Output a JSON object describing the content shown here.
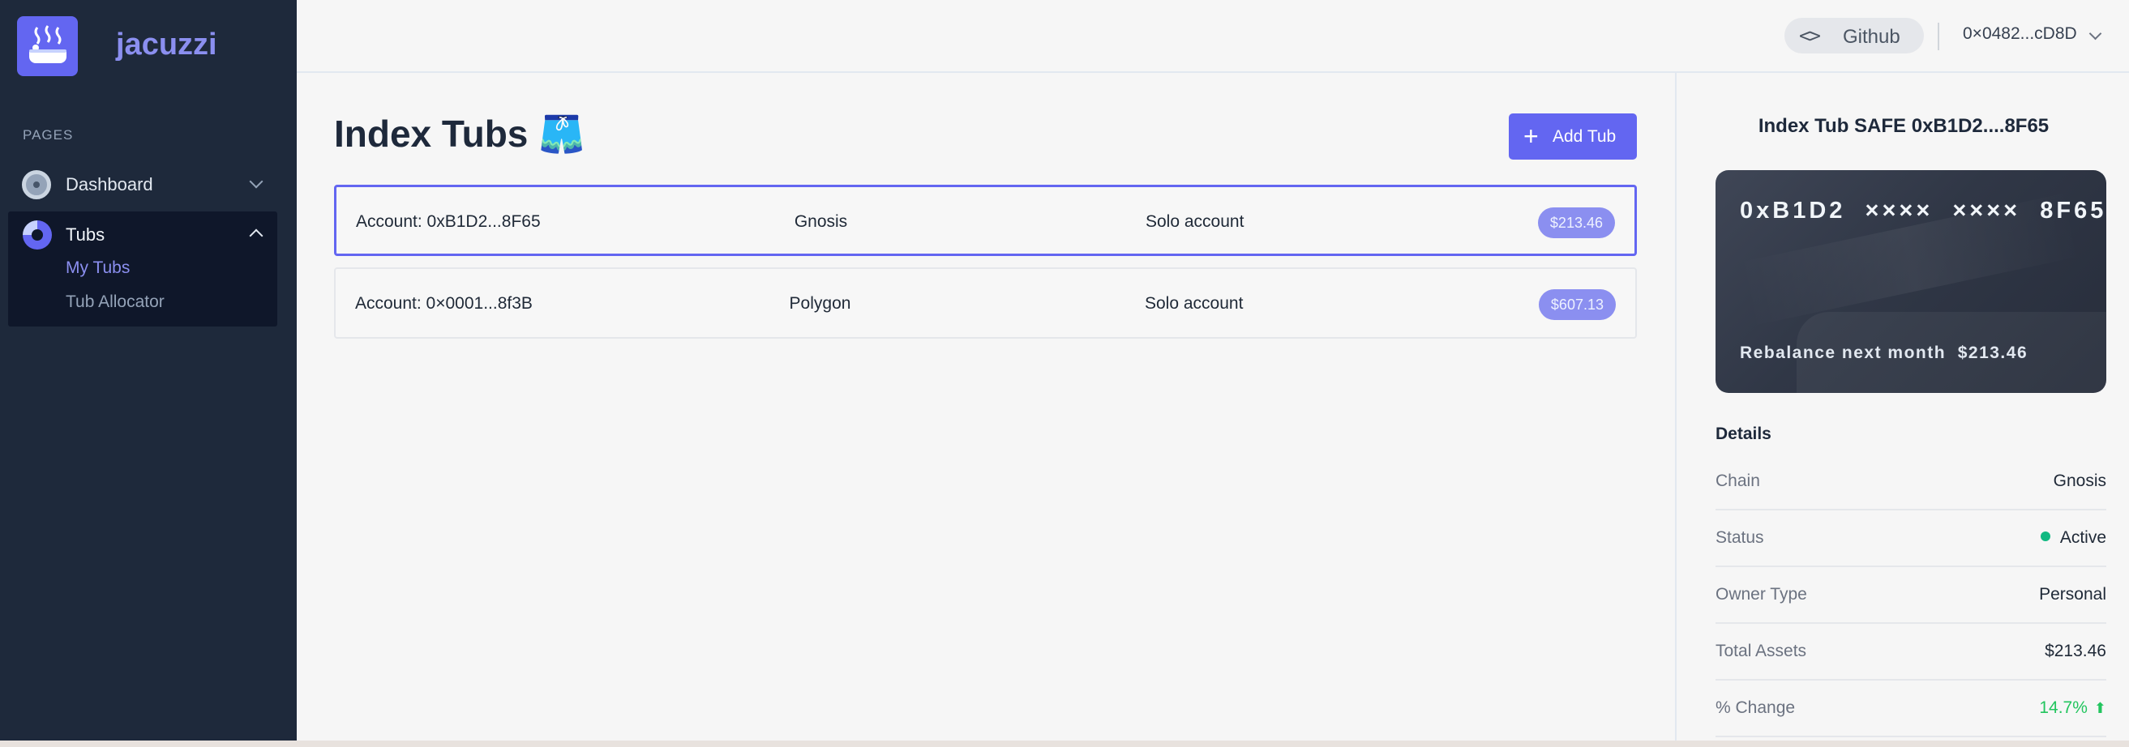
{
  "app": {
    "name": "jacuzzi"
  },
  "sidebar": {
    "section_label": "PAGES",
    "items": [
      {
        "label": "Dashboard",
        "icon": "dashboard-icon",
        "expanded": false
      },
      {
        "label": "Tubs",
        "icon": "pie-chart-icon",
        "expanded": true,
        "children": [
          {
            "label": "My Tubs",
            "active": true
          },
          {
            "label": "Tub Allocator",
            "active": false
          }
        ]
      }
    ]
  },
  "header": {
    "github_label": "Github",
    "github_icon": "code-icon",
    "wallet": "0×0482...cD8D"
  },
  "main": {
    "title": "Index Tubs 🩳",
    "add_button": "Add Tub",
    "tubs": [
      {
        "account": "Account: 0xB1D2...8F65",
        "chain": "Gnosis",
        "type": "Solo account",
        "balance": "$213.46",
        "selected": true
      },
      {
        "account": "Account: 0×0001...8f3B",
        "chain": "Polygon",
        "type": "Solo account",
        "balance": "$607.13",
        "selected": false
      }
    ]
  },
  "detail": {
    "title": "Index Tub SAFE 0xB1D2....8F65",
    "card_number": "0xB1D2  ××××  ××××  8F65",
    "card_footer": "Rebalance next month  $213.46",
    "details_heading": "Details",
    "rows": [
      {
        "key": "Chain",
        "value": "Gnosis"
      },
      {
        "key": "Status",
        "value": "Active"
      },
      {
        "key": "Owner Type",
        "value": "Personal"
      },
      {
        "key": "Total Assets",
        "value": "$213.46"
      },
      {
        "key": "% Change",
        "value": "14.7%"
      }
    ]
  },
  "colors": {
    "accent": "#6366f1",
    "sidebar_bg": "#1e293b",
    "positive": "#22c55e",
    "status_active": "#10b981"
  }
}
